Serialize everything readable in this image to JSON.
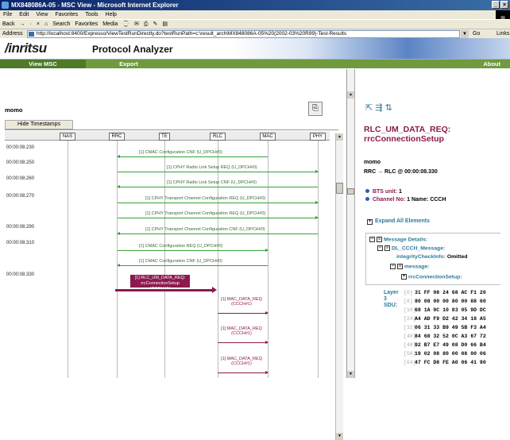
{
  "window": {
    "title": "MX848086A-05 - MSC View - Microsoft Internet Explorer",
    "controls": [
      "_",
      "×"
    ]
  },
  "menu": [
    "File",
    "Edit",
    "View",
    "Favorites",
    "Tools",
    "Help"
  ],
  "toolbar": {
    "items": [
      "Back",
      "→",
      "·",
      "×",
      "⌂",
      "Search",
      "Favorites",
      "Media",
      "⌚",
      "✉",
      "⎙",
      "✎",
      "▤"
    ]
  },
  "address": {
    "label": "Address",
    "url": "http://localhost:8400/Expresso/ViewTestRunDirectly.do?testRunPath=c:\\result_arch\\MX848086A-05%20(2002-03%20R99)-Test-Results",
    "go": "Go",
    "links": "Links"
  },
  "app": {
    "logo": "/inritsu",
    "title": "Protocol Analyzer"
  },
  "nav": {
    "view_msc": "View MSC",
    "export": "Export",
    "about": "About"
  },
  "msc": {
    "session": "momo",
    "hide_timestamps": "Hide Timestamps",
    "entities": [
      "NAS",
      "RRC",
      "TE",
      "RLC",
      "MAC",
      "PHY"
    ],
    "timestamps": [
      "00:00:08.230",
      "00:00:08.250",
      "00:00:08.260",
      "00:00:08.270",
      "00:00:08.290",
      "00:00:08.310",
      "00:00:08.330"
    ],
    "messages": [
      "[1] CMAC Configuration CNF (U_DPCH#0)",
      "[1] CPHY Radio Link Setup REQ (U_DPCH#0)",
      "[1] CPHY Radio Link Setup CNF (U_DPCH#0)",
      "[1] CPHY Transport Channel Configuration REQ (U_DPCH#0)",
      "[1] CPHY Transport Channel Configuration REQ (U_DPCH#0)",
      "[1] CPHY Transport Channel Configuration CNF (U_DPCH#0)",
      "[1] CMAC Configuration REQ (U_DPCH#0)",
      "[1] CMAC Configuration CNF (U_DPCH#0)"
    ],
    "selected": "[1] RLC_UM_DATA_REQ: rrcConnectionSetup (CCCH#1)",
    "mac": [
      "[1] MAC_DATA_REQ (CCCH#1)",
      "[1] MAC_DATA_REQ (CCCH#1)",
      "[1] MAC_DATA_REQ (CCCH#1)"
    ]
  },
  "detail": {
    "title": "RLC_UM_DATA_REQ: rrcConnectionSetup",
    "session": "momo",
    "route": "RRC → RLC @ 00:00:08.330",
    "bts_label": "BTS unit:",
    "bts_value": "1",
    "channel_label": "Channel No:",
    "channel_value": "1 Name: CCCH",
    "expand_all": "Expand All Elements",
    "tree": {
      "n1": "Message Details:",
      "n2": "DL_CCCH_Message:",
      "n3k": "integrityCheckInfo:",
      "n3v": "Omitted",
      "n4": "message:",
      "n5": "rrcConnectionSetup:"
    },
    "sdu_label": "Layer 3 SDU:",
    "hex": [
      {
        "off": "[0]",
        "bytes": "31 FF 08 24 68 AC F1 20"
      },
      {
        "off": "[8]",
        "bytes": "80 08 00 00 80 00 88 60"
      },
      {
        "off": "[16]",
        "bytes": "69 1A 0C 10 83 05 9D DC"
      },
      {
        "off": "[24]",
        "bytes": "A4 AD F9 D2 42 34 18 A5"
      },
      {
        "off": "[32]",
        "bytes": "06 31 33 B9 49 5B F3 A4"
      },
      {
        "off": "[40]",
        "bytes": "84 68 32 52 0C A3 67 72"
      },
      {
        "off": "[48]",
        "bytes": "92 B7 E7 49 08 D0 66 B4"
      },
      {
        "off": "[56]",
        "bytes": "19 02 08 80 00 08 00 06"
      },
      {
        "off": "[64]",
        "bytes": "47 FC D8 FE A0 06 41 90"
      }
    ]
  }
}
